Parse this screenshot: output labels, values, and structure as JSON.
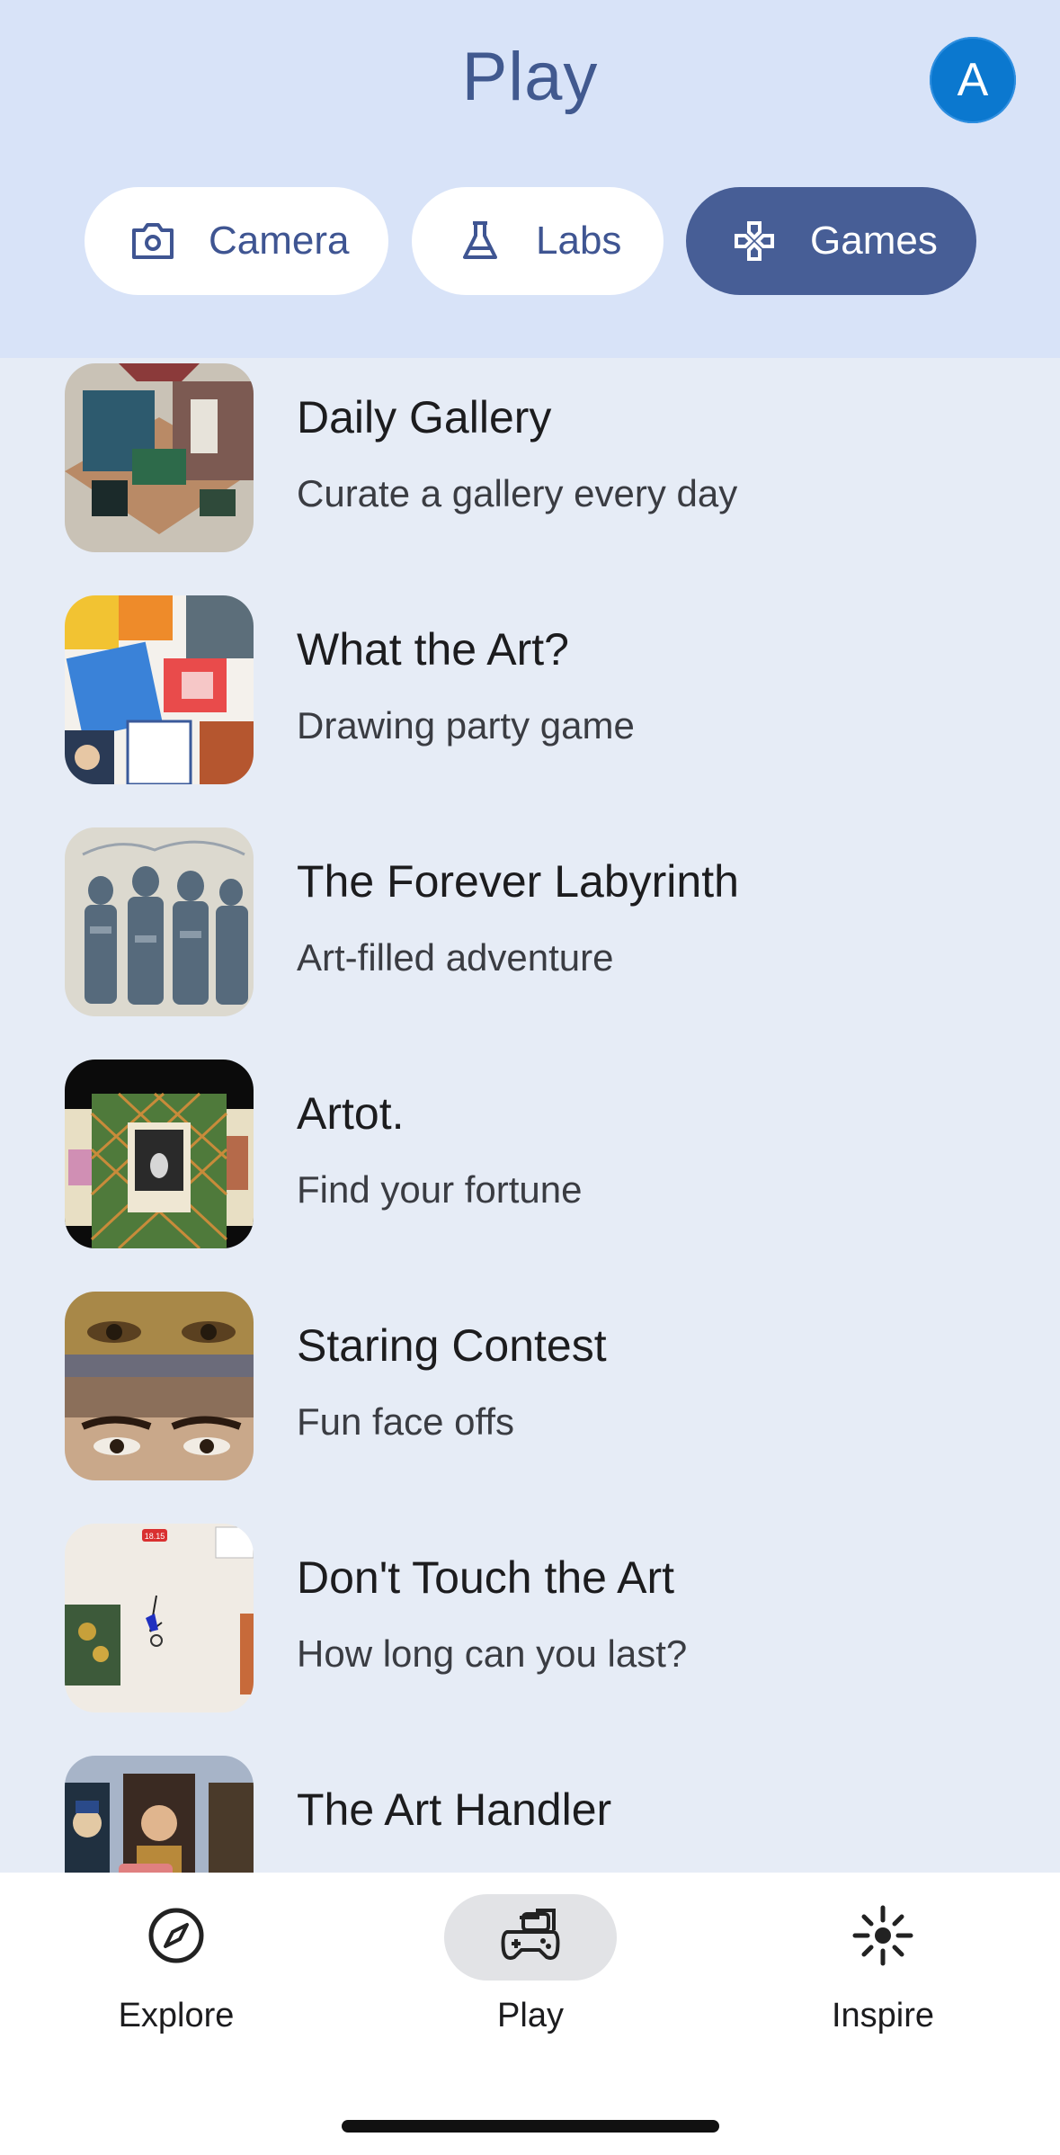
{
  "header": {
    "title": "Play",
    "avatar_letter": "A"
  },
  "tabs": [
    {
      "label": "Camera",
      "icon": "camera-icon",
      "active": false
    },
    {
      "label": "Labs",
      "icon": "flask-icon",
      "active": false
    },
    {
      "label": "Games",
      "icon": "games-icon",
      "active": true
    }
  ],
  "games": [
    {
      "name": "Daily Gallery",
      "description": "Curate a gallery every day"
    },
    {
      "name": "What the Art?",
      "description": "Drawing party game"
    },
    {
      "name": "The Forever Labyrinth",
      "description": "Art-filled adventure"
    },
    {
      "name": "Artot.",
      "description": "Find your fortune"
    },
    {
      "name": "Staring Contest",
      "description": "Fun face offs"
    },
    {
      "name": "Don't Touch the Art",
      "description": "How long can you last?"
    },
    {
      "name": "The Art Handler",
      "description": ""
    }
  ],
  "thumb_text": {
    "dont_touch_timer": "18.15"
  },
  "bottom_nav": [
    {
      "label": "Explore",
      "icon": "compass-icon",
      "active": false
    },
    {
      "label": "Play",
      "icon": "gamepad-icon",
      "active": true
    },
    {
      "label": "Inspire",
      "icon": "sparkle-icon",
      "active": false
    }
  ],
  "colors": {
    "header_bg": "#d8e3f8",
    "accent": "#475e96",
    "avatar": "#0b78cf",
    "list_bg": "#e6ecf6"
  }
}
